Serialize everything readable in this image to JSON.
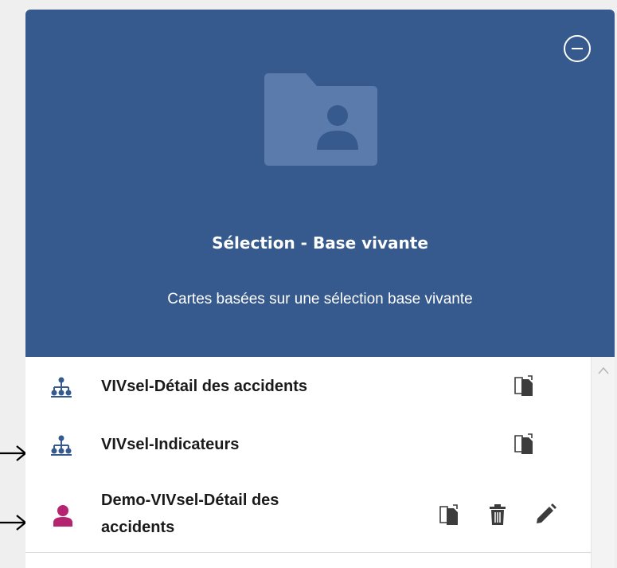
{
  "header": {
    "title": "Sélection - Base vivante",
    "subtitle": "Cartes basées sur une sélection base vivante"
  },
  "items": [
    {
      "label": "VIVsel-Détail des accidents",
      "icon": "hierarchy-icon",
      "actions": [
        "copy-icon"
      ]
    },
    {
      "label": "VIVsel-Indicateurs",
      "icon": "hierarchy-icon",
      "actions": [
        "copy-icon"
      ]
    },
    {
      "label_line1": "Demo-VIVsel-Détail des",
      "label_line2": "accidents",
      "icon": "user-icon",
      "actions": [
        "copy-icon",
        "trash-icon",
        "edit-icon"
      ]
    }
  ],
  "colors": {
    "header_bg": "#365a8d",
    "shared_icon": "#365a8d",
    "user_icon": "#b5246f",
    "action_icon": "#3c3c3c"
  }
}
